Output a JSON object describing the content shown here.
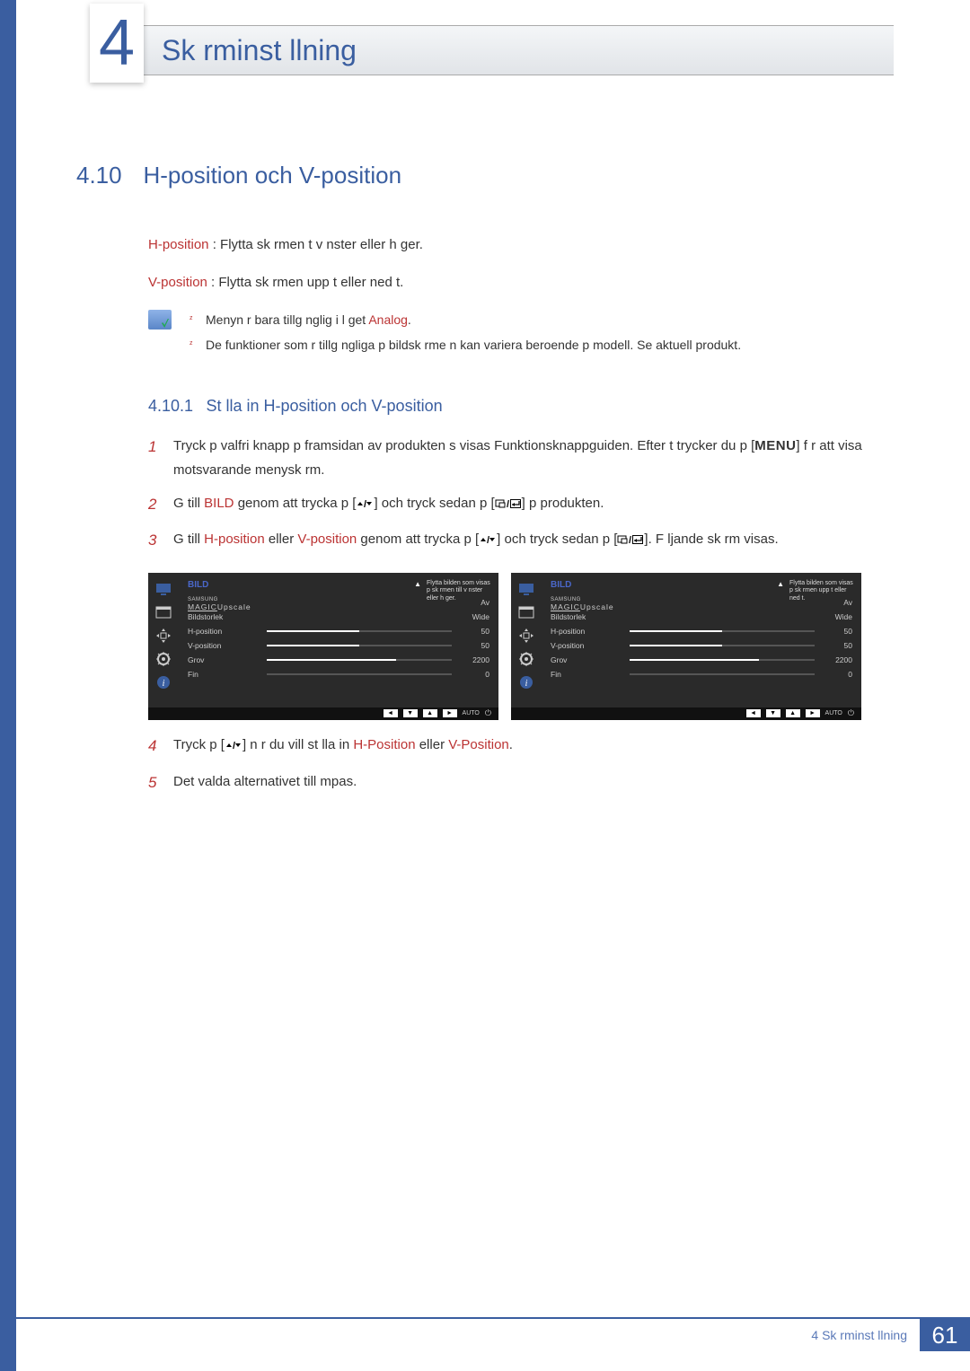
{
  "header": {
    "chapter_number": "4",
    "chapter_title": "Sk rminst llning"
  },
  "section": {
    "number": "4.10",
    "title": "H-position och V-position"
  },
  "definitions": {
    "hpos_term": "H-position",
    "hpos_desc": " : Flytta sk rmen  t v nster eller h ger.",
    "vpos_term": "V-position",
    "vpos_desc": " : Flytta sk rmen upp t eller ned t."
  },
  "info_notes": {
    "line1_a": "Menyn  r bara tillg nglig i l get ",
    "line1_b": "Analog",
    "line1_c": ".",
    "line2": "De funktioner som  r tillg ngliga p  bildsk rme n kan variera beroende p  modell. Se aktuell produkt."
  },
  "subsection": {
    "number": "4.10.1",
    "title": "St lla in H-position och V-position"
  },
  "steps": {
    "s1": {
      "num": "1",
      "a": "Tryck p  valfri knapp p  framsidan av produkten s  visas Funktionsknappguiden. Efter t trycker du p  [",
      "menu": "MENU",
      "b": "] f r att visa  motsvarande menysk rm."
    },
    "s2": {
      "num": "2",
      "a": "G  till ",
      "bild": "BILD",
      "b": " genom att trycka p  [",
      "c": "] och tryck sedan p  [",
      "d": "] p  produkten."
    },
    "s3": {
      "num": "3",
      "a": "G  till ",
      "hp": "H-position",
      "b": "  eller ",
      "vp": "V-position",
      "c": " genom att trycka p  [",
      "d": "] och tryck sedan p  [",
      "e": "]. F ljande sk rm visas."
    },
    "s4": {
      "num": "4",
      "a": "Tryck p  [",
      "b": "] n r du vill st lla in ",
      "hp": "H-Position",
      "c": "  eller ",
      "vp": "V-Position",
      "d": "."
    },
    "s5": {
      "num": "5",
      "a": "Det valda alternativet till mpas."
    }
  },
  "osd": {
    "title": "BILD",
    "magic_prefix": "SAMSUNG",
    "magic_word": "MAGIC",
    "magic_suffix": "Upscale",
    "upscale_val": "Av",
    "bildstorlek": "Bildstorlek",
    "bildstorlek_val": "Wide",
    "hpos": "H-position",
    "hpos_val": "50",
    "vpos": "V-position",
    "vpos_val": "50",
    "grov": "Grov",
    "grov_val": "2200",
    "fin": "Fin",
    "fin_val": "0",
    "desc_h": "Flytta bilden som visas p  sk rmen till v nster eller h ger.",
    "desc_v": "Flytta bilden som visas p  sk rmen upp t eller ned t.",
    "auto": "AUTO"
  },
  "footer": {
    "text": "4 Sk rminst llning",
    "page": "61"
  }
}
